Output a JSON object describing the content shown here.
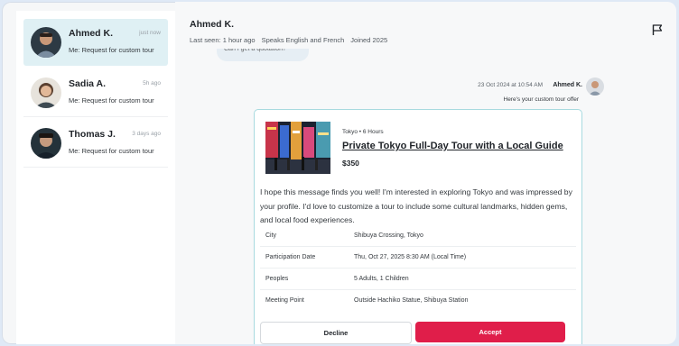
{
  "conversations": [
    {
      "name": "Ahmed K.",
      "time": "just now",
      "preview": "Me:  Request for custom tour",
      "active": true
    },
    {
      "name": "Sadia A.",
      "time": "5h ago",
      "preview": "Me:  Request for custom tour",
      "active": false
    },
    {
      "name": "Thomas J.",
      "time": "3 days ago",
      "preview": "Me:  Request for custom tour",
      "active": false
    }
  ],
  "header": {
    "name": "Ahmed K.",
    "last_seen": "Last seen: 1 hour ago",
    "languages": "Speaks English and French",
    "joined": "Joined 2025"
  },
  "previous_message": "Can I get a quotation?",
  "message": {
    "timestamp": "23 Oct 2024 at 10:54 AM",
    "author": "Ahmed K.",
    "caption": "Here's your custom tour offer"
  },
  "offer": {
    "tags": "Tokyo  •  6 Hours",
    "title": "Private Tokyo Full-Day Tour with a Local Guide",
    "price": "$350",
    "text": "I hope this message finds you well! I'm interested in exploring Tokyo and was impressed by your profile. I'd love to customize a tour to include some cultural landmarks, hidden gems, and local food experiences.",
    "details": [
      {
        "label": "City",
        "value": "Shibuya Crossing, Tokyo"
      },
      {
        "label": "Participation  Date",
        "value": "Thu, Oct 27, 2025 8:30 AM (Local Time)"
      },
      {
        "label": "Peoples",
        "value": "5 Adults, 1 Children"
      },
      {
        "label": "Meeting Point",
        "value": "Outside Hachiko Statue, Shibuya Station"
      }
    ],
    "decline_label": "Decline",
    "accept_label": "Accept"
  },
  "colors": {
    "accent": "#e01e4a",
    "active_item": "#dff0f4",
    "card_border": "#a8dadf"
  },
  "icons": {
    "header_action": "flag-icon"
  }
}
